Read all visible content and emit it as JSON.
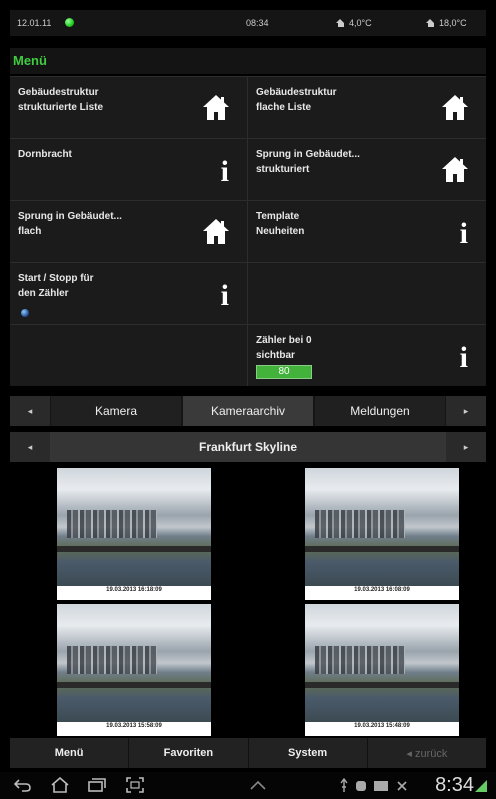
{
  "status": {
    "date": "12.01.11",
    "time": "08:34",
    "temp_outside": "4,0°C",
    "temp_inside": "18,0°C"
  },
  "menu": {
    "title": "Menü"
  },
  "tiles": [
    {
      "label1": "Gebäudestruktur",
      "label2": "strukturierte Liste",
      "icon": "house-icon"
    },
    {
      "label1": "Gebäudestruktur",
      "label2": "flache Liste",
      "icon": "house-icon"
    },
    {
      "label1": "Dornbracht",
      "label2": "",
      "icon": "info-icon"
    },
    {
      "label1": "Sprung in Gebäudet...",
      "label2": "strukturiert",
      "icon": "house-icon"
    },
    {
      "label1": "Sprung in Gebäudet...",
      "label2": "flach",
      "icon": "house-icon"
    },
    {
      "label1": "Template",
      "label2": "Neuheiten",
      "icon": "info-icon"
    },
    {
      "label1": "Start / Stopp für",
      "label2": "den Zähler",
      "icon": "info-icon"
    },
    {
      "label1": "",
      "label2": "",
      "icon": ""
    },
    {
      "label1": "",
      "label2": "",
      "icon": ""
    },
    {
      "label1": "Zähler bei 0",
      "label2": "sichtbar",
      "icon": "info-icon",
      "counter": "80"
    }
  ],
  "info_glyph": "i",
  "tabs": {
    "items": [
      "Kamera",
      "Kameraarchiv",
      "Meldungen"
    ],
    "active": "Kameraarchiv",
    "left_arrow": "◂",
    "right_arrow": "▸"
  },
  "camera": {
    "title": "Frankfurt Skyline"
  },
  "photos": [
    {
      "caption": "19.03.2013 16:18:09"
    },
    {
      "caption": "19.03.2013 16:08:09"
    },
    {
      "caption": "19.03.2013 15:58:09"
    },
    {
      "caption": "19.03.2013 15:48:09"
    }
  ],
  "bottom_nav": [
    "Menü",
    "Favoriten",
    "System",
    "◂  zurück"
  ],
  "system_bar": {
    "clock": "8:34"
  },
  "colors": {
    "accent_green": "#3fcc3f",
    "counter_green": "#43b23a"
  }
}
